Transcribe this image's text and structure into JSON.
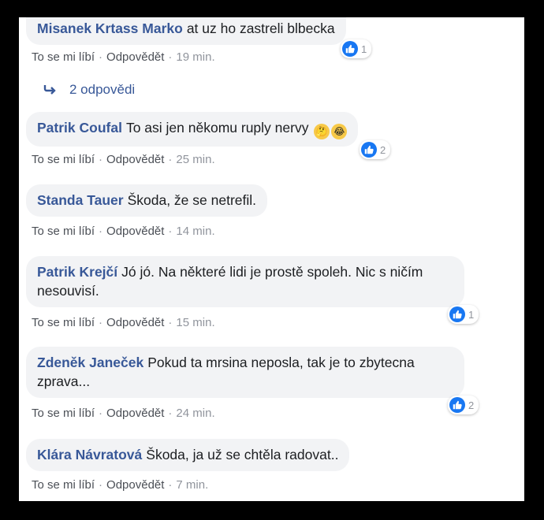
{
  "meta": {
    "like_color": "#1877f2",
    "name_color": "#385898",
    "bubble_color": "#f2f3f5"
  },
  "comments": [
    {
      "author": "Misanek Krtass Marko",
      "text": "at uz ho zastreli blbecka",
      "like": "To se mi líbí",
      "reply": "Odpovědět",
      "time": "19 min.",
      "reactions": "1",
      "reaction_icons": [
        "like-icon"
      ]
    },
    {
      "author": "Patrik Coufal",
      "text": "To asi jen někomu ruply nervy",
      "like": "To se mi líbí",
      "reply": "Odpovědět",
      "time": "25 min.",
      "reactions": "2",
      "reaction_icons": [
        "like-icon",
        "haha-icon"
      ],
      "inline_emojis": [
        "thinking-emoji",
        "laughing-emoji"
      ]
    },
    {
      "author": "Standa Tauer",
      "text": "Škoda, že se netrefil.",
      "like": "To se mi líbí",
      "reply": "Odpovědět",
      "time": "14 min."
    },
    {
      "author": "Patrik Krejčí",
      "text": "Jó jó. Na některé lidi je prostě spoleh. Nic s ničím nesouvisí.",
      "like": "To se mi líbí",
      "reply": "Odpovědět",
      "time": "15 min.",
      "reactions": "1",
      "reaction_icons": [
        "like-icon"
      ]
    },
    {
      "author": "Zdeněk Janeček",
      "text": "Pokud ta mrsina neposla, tak je to zbytecna zprava...",
      "like": "To se mi líbí",
      "reply": "Odpovědět",
      "time": "24 min.",
      "reactions": "2",
      "reaction_icons": [
        "like-icon"
      ]
    },
    {
      "author": "Klára Návratová",
      "text": "Škoda, ja už se chtěla radovat..",
      "like": "To se mi líbí",
      "reply": "Odpovědět",
      "time": "7 min."
    }
  ],
  "replies_link": "2 odpovědi",
  "separator": "·"
}
